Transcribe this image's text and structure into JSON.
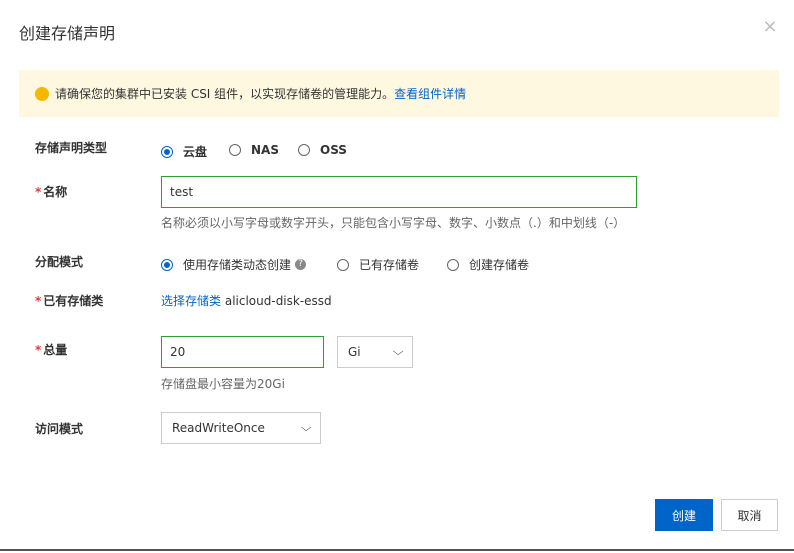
{
  "dialog": {
    "title": "创建存储声明",
    "close_glyph": "×"
  },
  "notice": {
    "message": "请确保您的集群中已安装 CSI 组件，以实现存储卷的管理能力。",
    "link": "查看组件详情"
  },
  "form": {
    "type": {
      "label": "存储声明类型",
      "options": [
        "云盘",
        "NAS",
        "OSS"
      ],
      "selected": "云盘"
    },
    "name": {
      "required": "*",
      "label": "名称",
      "value": "test",
      "help": "名称必须以小写字母或数字开头，只能包含小写字母、数字、小数点（.）和中划线（-）"
    },
    "alloc": {
      "label": "分配模式",
      "options": [
        "使用存储类动态创建",
        "已有存储卷",
        "创建存储卷"
      ],
      "selected": "使用存储类动态创建",
      "help_glyph": "?"
    },
    "storage_class": {
      "required": "*",
      "label": "已有存储类",
      "link": "选择存储类",
      "value": "alicloud-disk-essd"
    },
    "total": {
      "required": "*",
      "label": "总量",
      "value": "20",
      "unit": "Gi",
      "help": "存储盘最小容量为20Gi"
    },
    "access": {
      "label": "访问模式",
      "value": "ReadWriteOnce"
    }
  },
  "footer": {
    "create": "创建",
    "cancel": "取消"
  },
  "icons": {
    "warning": "warning-dot-icon",
    "close": "close-icon",
    "chevron": "chevron-down-icon"
  },
  "colors": {
    "primary": "#0064c8",
    "notice_bg": "#fff8e1",
    "warning": "#f5b800",
    "input_border": "#2ca02c",
    "required": "#e4393c"
  }
}
